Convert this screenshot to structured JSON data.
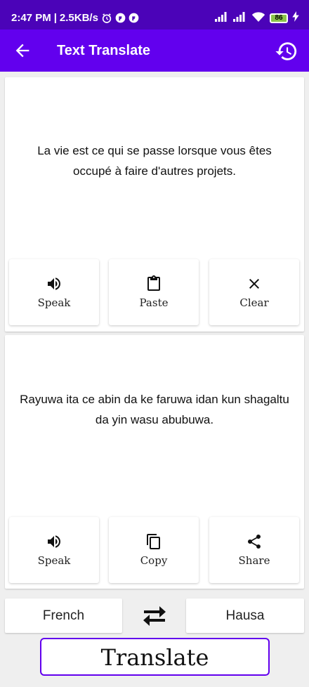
{
  "status_bar": {
    "time": "2:47 PM",
    "speed": "2.5KB/s",
    "battery": "86",
    "icons": [
      "alarm-icon",
      "f-icon",
      "f-icon",
      "signal-icon",
      "signal-icon",
      "wifi-icon",
      "battery-icon",
      "charging-icon"
    ]
  },
  "app_bar": {
    "title": "Text Translate",
    "back_icon": "arrow-back-icon",
    "history_icon": "history-icon"
  },
  "source": {
    "text": "La vie est ce qui se passe lorsque vous êtes occupé à faire d'autres projets.",
    "buttons": [
      {
        "label": "Speak",
        "icon": "speaker-icon"
      },
      {
        "label": "Paste",
        "icon": "clipboard-icon"
      },
      {
        "label": "Clear",
        "icon": "close-icon"
      }
    ]
  },
  "target": {
    "text": "Rayuwa ita ce abin da ke faruwa idan kun shagaltu da yin wasu abubuwa.",
    "buttons": [
      {
        "label": "Speak",
        "icon": "speaker-icon"
      },
      {
        "label": "Copy",
        "icon": "copy-icon"
      },
      {
        "label": "Share",
        "icon": "share-icon"
      }
    ]
  },
  "languages": {
    "source": "French",
    "target": "Hausa",
    "swap_icon": "swap-icon"
  },
  "translate_label": "Translate",
  "colors": {
    "status_bar": "#4b03b8",
    "app_bar": "#6200ee",
    "background": "#efefef",
    "translate_border": "#6200ee"
  }
}
